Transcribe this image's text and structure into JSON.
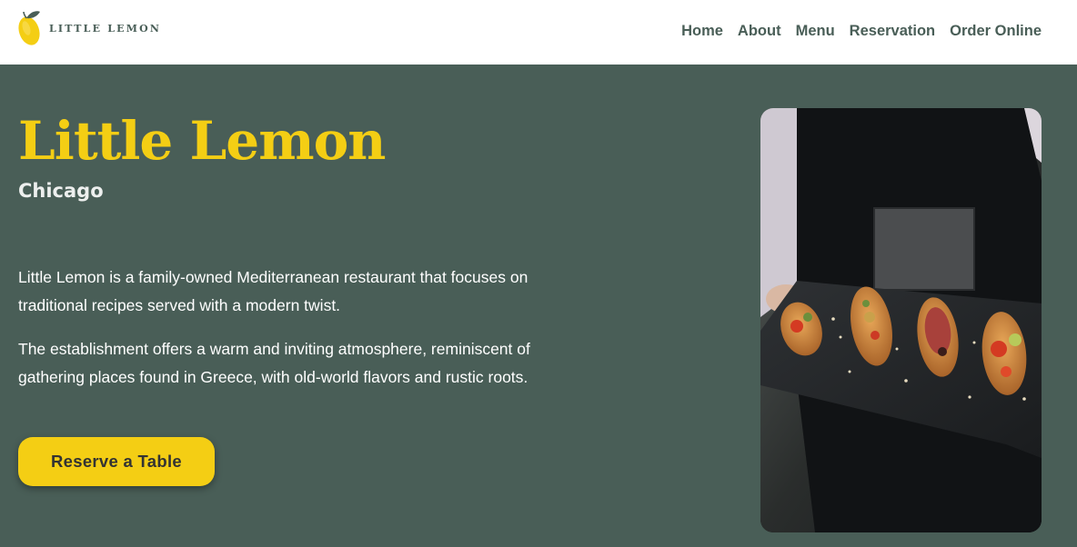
{
  "header": {
    "logo_text": "LITTLE LEMON",
    "nav": [
      {
        "label": "Home"
      },
      {
        "label": "About"
      },
      {
        "label": "Menu"
      },
      {
        "label": "Reservation"
      },
      {
        "label": "Order Online"
      }
    ]
  },
  "hero": {
    "title": "Little Lemon",
    "subtitle": "Chicago",
    "paragraph_1": "Little Lemon is a family-owned Mediterranean restaurant that focuses on traditional recipes served with a modern twist.",
    "paragraph_2": "The establishment offers a warm and inviting atmosphere, reminiscent of gathering places found in Greece, with old-world flavors and rustic roots.",
    "cta_label": "Reserve a Table"
  },
  "colors": {
    "primary_green": "#495E57",
    "primary_yellow": "#F4CE14",
    "light_text": "#EDEFEE",
    "white": "#FFFFFF"
  },
  "icons": {
    "logo": "lemon-icon",
    "hero_image": "food-platter-photo"
  }
}
